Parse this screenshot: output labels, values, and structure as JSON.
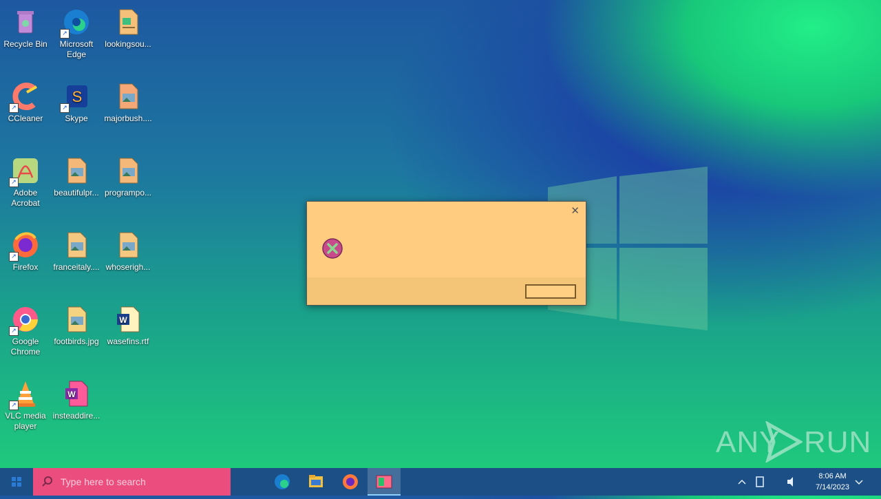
{
  "desktop": {
    "icons": [
      {
        "label": "Recycle Bin"
      },
      {
        "label": "Microsoft Edge"
      },
      {
        "label": "lookingsou..."
      },
      {
        "label": "CCleaner"
      },
      {
        "label": "Skype"
      },
      {
        "label": "majorbush...."
      },
      {
        "label": "Adobe Acrobat"
      },
      {
        "label": "beautifulpr..."
      },
      {
        "label": "programpo..."
      },
      {
        "label": "Firefox"
      },
      {
        "label": "franceitaly...."
      },
      {
        "label": "whoserigh..."
      },
      {
        "label": "Google Chrome"
      },
      {
        "label": "footbirds.jpg"
      },
      {
        "label": "wasefins.rtf"
      },
      {
        "label": "VLC media player"
      },
      {
        "label": "insteaddire..."
      }
    ]
  },
  "dialog": {
    "close_glyph": "✕",
    "message": "",
    "ok_label": ""
  },
  "watermark": {
    "left": "ANY",
    "right": "RUN"
  },
  "taskbar": {
    "search_placeholder": "Type here to search",
    "apps": [
      {
        "name": "Microsoft Edge"
      },
      {
        "name": "File Explorer"
      },
      {
        "name": "Firefox"
      },
      {
        "name": "Active application"
      }
    ],
    "clock_time": "8:06 AM",
    "clock_date": "7/14/2023"
  },
  "colors": {
    "dialog_bg": "#ffcc80",
    "search_bg": "#ea4d7e",
    "taskbar_bg": "#1b4f86"
  }
}
